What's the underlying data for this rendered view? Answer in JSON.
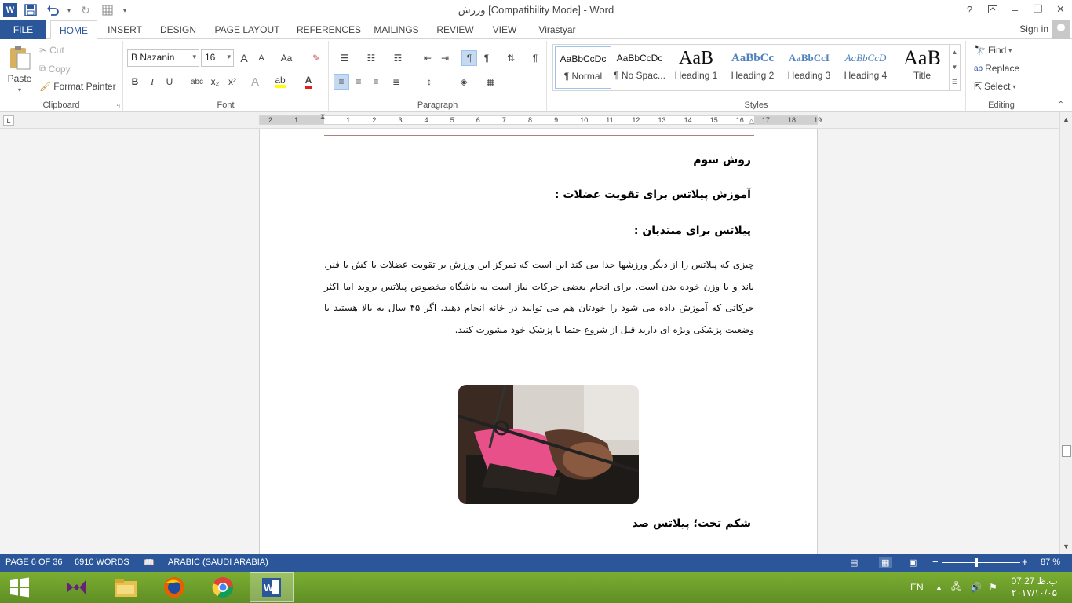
{
  "window": {
    "title": "ورزش [Compatibility Mode] - Word",
    "help": "?",
    "minimize": "–",
    "restore": "❐",
    "close": "✕"
  },
  "tabs": [
    "FILE",
    "HOME",
    "INSERT",
    "DESIGN",
    "PAGE LAYOUT",
    "REFERENCES",
    "MAILINGS",
    "REVIEW",
    "VIEW",
    "Virastyar"
  ],
  "signin": "Sign in",
  "clipboard": {
    "paste": "Paste",
    "cut": "Cut",
    "copy": "Copy",
    "format_painter": "Format Painter",
    "label": "Clipboard"
  },
  "font": {
    "name": "B Nazanin",
    "size": "16",
    "label": "Font",
    "bold": "B",
    "italic": "I",
    "underline": "U",
    "strike": "abc",
    "sub": "x₂",
    "sup": "x²",
    "grow": "A",
    "shrink": "A",
    "case": "Aa",
    "effects": "A"
  },
  "paragraph": {
    "label": "Paragraph",
    "pilcrow": "¶"
  },
  "styles": {
    "label": "Styles",
    "items": [
      {
        "preview": "AaBbCcDc",
        "name": "¶ Normal"
      },
      {
        "preview": "AaBbCcDc",
        "name": "¶ No Spac..."
      },
      {
        "preview": "AaB",
        "name": "Heading 1"
      },
      {
        "preview": "AaBbCc",
        "name": "Heading 2"
      },
      {
        "preview": "AaBbCcI",
        "name": "Heading 3"
      },
      {
        "preview": "AaBbCcD",
        "name": "Heading 4"
      },
      {
        "preview": "AaB",
        "name": "Title"
      }
    ]
  },
  "editing": {
    "label": "Editing",
    "find": "Find",
    "replace": "Replace",
    "select": "Select"
  },
  "ruler": {
    "tab_selector": "L",
    "numbers": [
      "2",
      "1",
      "1",
      "2",
      "3",
      "4",
      "5",
      "6",
      "7",
      "8",
      "9",
      "10",
      "11",
      "12",
      "13",
      "14",
      "15",
      "16",
      "17",
      "18",
      "19"
    ]
  },
  "document": {
    "heading1": "روش سوم",
    "heading2": "آموزش پیلاتس برای تقویت عضلات :",
    "heading3": "پیلاتس برای مبتدیان :",
    "paragraph": "چیزی که پیلاتس را از دیگر ورزشها جدا می کند این است که تمرکز این ورزش بر تقویت عضلات با کش یا فنر، باند و یا وزن خوده بدن است. برای انجام بعضی حرکات نیاز است به باشگاه مخصوص پیلاتس بروید اما اکثر حرکاتی که آموزش داده می شود را خودتان هم می توانید در خانه انجام دهید. اگر ۴۵ سال به بالا هستید یا وضعیت پزشکی ویژه ای دارید قبل از شروع حتما با پزشک خود مشورت کنید.",
    "heading4": "شکم تخت؛ پیلاتس صد"
  },
  "status": {
    "page": "PAGE 6 OF 36",
    "words": "6910 WORDS",
    "language": "ARABIC (SAUDI ARABIA)",
    "zoom": "87 %",
    "zoom_minus": "−",
    "zoom_plus": "+"
  },
  "taskbar": {
    "lang": "EN",
    "time": "07:27 ب.ظ",
    "date": "۲۰۱۷/۱۰/۰۵"
  },
  "colors": {
    "accent": "#2b579a",
    "taskbar": "#6fa02b"
  }
}
